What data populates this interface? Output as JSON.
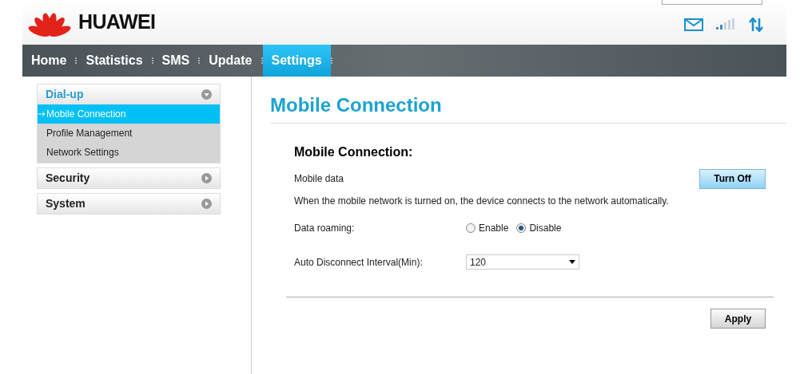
{
  "header": {
    "logo_text": "HUAWEI"
  },
  "nav": [
    {
      "label": "Home",
      "selected": false
    },
    {
      "label": "Statistics",
      "selected": false
    },
    {
      "label": "SMS",
      "selected": false
    },
    {
      "label": "Update",
      "selected": false
    },
    {
      "label": "Settings",
      "selected": true
    }
  ],
  "sidebar": [
    {
      "label": "Dial-up",
      "expanded": true,
      "children": [
        {
          "label": "Mobile Connection",
          "selected": true
        },
        {
          "label": "Profile Management",
          "selected": false
        },
        {
          "label": "Network Settings",
          "selected": false
        }
      ]
    },
    {
      "label": "Security",
      "expanded": false
    },
    {
      "label": "System",
      "expanded": false
    }
  ],
  "page_title": "Mobile Connection",
  "section_title": "Mobile Connection:",
  "mobile_data": {
    "label": "Mobile data",
    "button": "Turn Off"
  },
  "note": "When the mobile network is turned on, the device connects to the network automatically.",
  "roaming": {
    "label": "Data roaming:",
    "options": [
      {
        "label": "Enable",
        "selected": false
      },
      {
        "label": "Disable",
        "selected": true
      }
    ]
  },
  "interval": {
    "label": "Auto Disconnect Interval(Min):",
    "value": "120"
  },
  "apply_button": "Apply"
}
